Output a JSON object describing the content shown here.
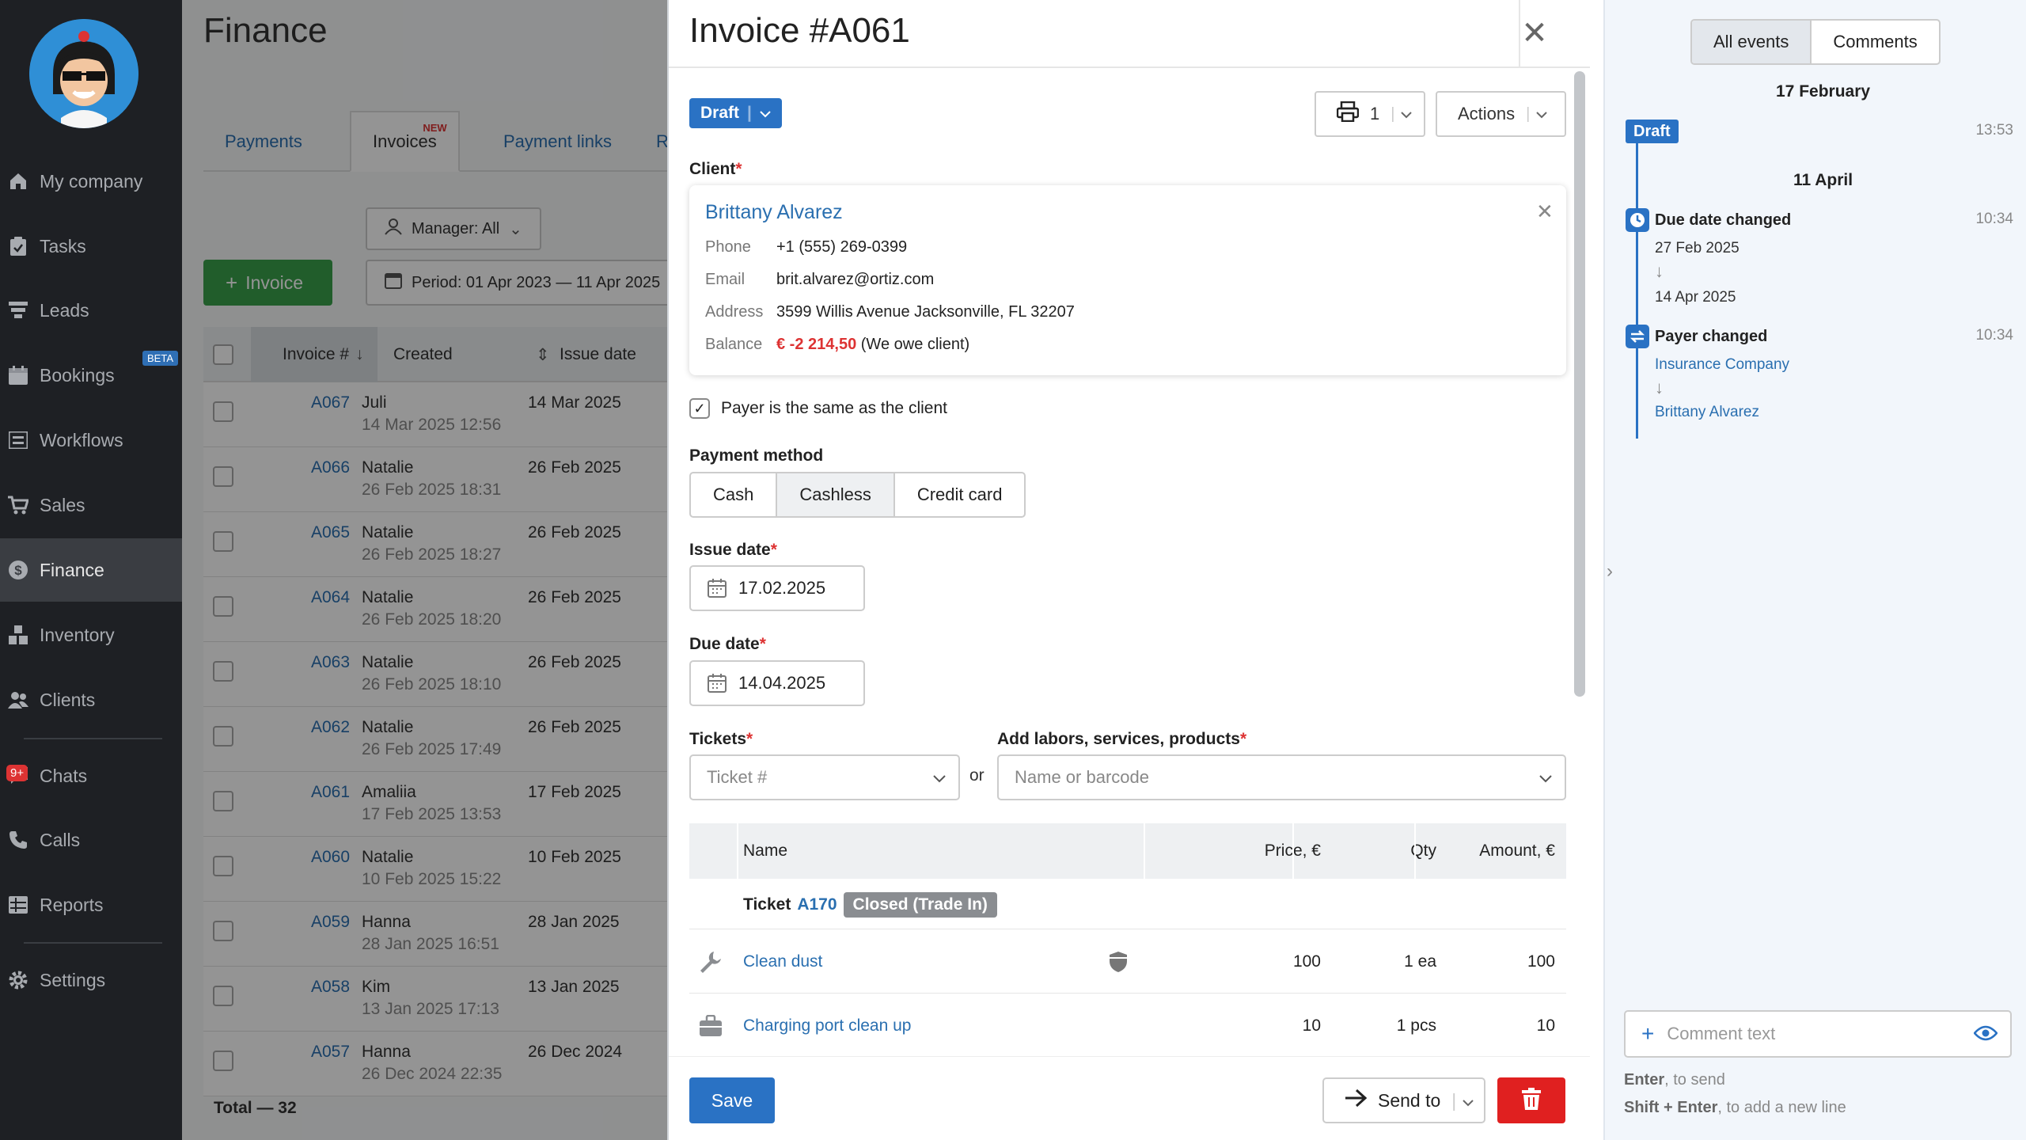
{
  "sidebar": {
    "items": [
      {
        "label": "My company",
        "icon": "home-icon"
      },
      {
        "label": "Tasks",
        "icon": "clipboard-icon"
      },
      {
        "label": "Leads",
        "icon": "filter-icon"
      },
      {
        "label": "Bookings",
        "icon": "calendar-icon",
        "badge": "BETA"
      },
      {
        "label": "Workflows",
        "icon": "list-icon"
      },
      {
        "label": "Sales",
        "icon": "cart-icon"
      },
      {
        "label": "Finance",
        "icon": "dollar-icon",
        "active": true
      },
      {
        "label": "Inventory",
        "icon": "boxes-icon"
      },
      {
        "label": "Clients",
        "icon": "users-icon"
      },
      {
        "label": "Chats",
        "icon": "chat-icon",
        "badge": "9+"
      },
      {
        "label": "Calls",
        "icon": "phone-icon"
      },
      {
        "label": "Reports",
        "icon": "grid-icon"
      },
      {
        "label": "Settings",
        "icon": "gear-icon"
      }
    ]
  },
  "finance": {
    "title": "Finance",
    "tabs": [
      {
        "label": "Payments"
      },
      {
        "label": "Invoices",
        "badge": "NEW",
        "active": true
      },
      {
        "label": "Payment links"
      },
      {
        "label": "Refunds"
      }
    ],
    "manager_filter": "Manager: All",
    "add_invoice": "Invoice",
    "period": "Period: 01 Apr 2023 — 11 Apr 2025",
    "columns": {
      "number": "Invoice #",
      "created": "Created",
      "issue": "Issue date"
    },
    "rows": [
      {
        "number": "A067",
        "who": "Juli",
        "when": "14 Mar 2025 12:56",
        "issue": "14 Mar 2025"
      },
      {
        "number": "A066",
        "who": "Natalie",
        "when": "26 Feb 2025 18:31",
        "issue": "26 Feb 2025"
      },
      {
        "number": "A065",
        "who": "Natalie",
        "when": "26 Feb 2025 18:27",
        "issue": "26 Feb 2025"
      },
      {
        "number": "A064",
        "who": "Natalie",
        "when": "26 Feb 2025 18:20",
        "issue": "26 Feb 2025"
      },
      {
        "number": "A063",
        "who": "Natalie",
        "when": "26 Feb 2025 18:10",
        "issue": "26 Feb 2025"
      },
      {
        "number": "A062",
        "who": "Natalie",
        "when": "26 Feb 2025 17:49",
        "issue": "26 Feb 2025"
      },
      {
        "number": "A061",
        "who": "Amaliia",
        "when": "17 Feb 2025 13:53",
        "issue": "17 Feb 2025"
      },
      {
        "number": "A060",
        "who": "Natalie",
        "when": "10 Feb 2025 15:22",
        "issue": "10 Feb 2025"
      },
      {
        "number": "A059",
        "who": "Hanna",
        "when": "28 Jan 2025 16:51",
        "issue": "28 Jan 2025"
      },
      {
        "number": "A058",
        "who": "Kim",
        "when": "13 Jan 2025 17:13",
        "issue": "13 Jan 2025"
      },
      {
        "number": "A057",
        "who": "Hanna",
        "when": "26 Dec 2024 22:35",
        "issue": "26 Dec 2024"
      }
    ],
    "total": "Total — 32"
  },
  "invoice": {
    "title": "Invoice #A061",
    "status": "Draft",
    "print_count": "1",
    "actions_label": "Actions",
    "client_label": "Client",
    "client": {
      "name": "Brittany Alvarez",
      "phone_label": "Phone",
      "phone": "+1 (555) 269-0399",
      "email_label": "Email",
      "email": "brit.alvarez@ortiz.com",
      "address_label": "Address",
      "address": "3599 Willis Avenue Jacksonville, FL 32207",
      "balance_label": "Balance",
      "balance": "€ -2 214,50",
      "balance_note": "(We owe client)"
    },
    "payer_same_label": "Payer is the same as the client",
    "payment_method_label": "Payment method",
    "payment_methods": [
      "Cash",
      "Cashless",
      "Credit card"
    ],
    "payment_method_selected": "Cashless",
    "issue_date_label": "Issue date",
    "issue_date": "17.02.2025",
    "due_date_label": "Due date",
    "due_date": "14.04.2025",
    "tickets_label": "Tickets",
    "tickets_placeholder": "Ticket #",
    "or_label": "or",
    "add_items_label": "Add labors, services, products",
    "add_items_placeholder": "Name or barcode",
    "table_columns": {
      "name": "Name",
      "price": "Price, €",
      "qty": "Qty",
      "amount": "Amount, €"
    },
    "ticket_group": {
      "prefix": "Ticket",
      "number": "A170",
      "status": "Closed (Trade In)"
    },
    "items": [
      {
        "name": "Clean dust",
        "icon": "wrench-icon",
        "price": "100",
        "qty": "1 ea",
        "amount": "100"
      },
      {
        "name": "Charging port clean up",
        "icon": "briefcase-icon",
        "price": "10",
        "qty": "1 pcs",
        "amount": "10"
      }
    ],
    "save_label": "Save",
    "send_to_label": "Send to"
  },
  "events": {
    "tabs": [
      "All events",
      "Comments"
    ],
    "groups": [
      {
        "date": "17 February"
      },
      {
        "date": "11 April"
      }
    ],
    "draft_badge": "Draft",
    "draft_time": "13:53",
    "due_changed": {
      "title": "Due date changed",
      "time": "10:34",
      "from": "27 Feb 2025",
      "to": "14 Apr 2025"
    },
    "payer_changed": {
      "title": "Payer changed",
      "time": "10:34",
      "from": "Insurance Company",
      "to": "Brittany Alvarez"
    },
    "comment_placeholder": "Comment text",
    "hint_enter_key": "Enter",
    "hint_enter_text": ", to send",
    "hint_shift_key": "Shift + Enter",
    "hint_shift_text": ", to add a new line"
  },
  "colors": {
    "accent": "#2a72c4",
    "danger": "#e02020",
    "success": "#3aa14a",
    "sidebar": "#1e2024"
  }
}
